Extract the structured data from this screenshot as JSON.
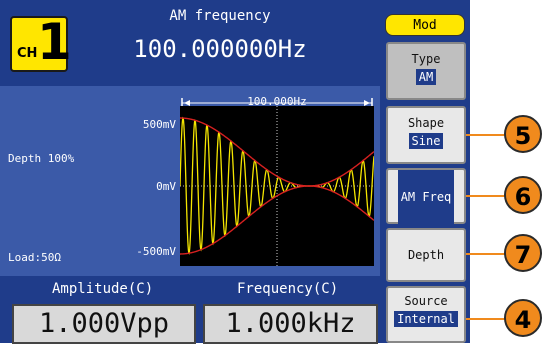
{
  "channel": {
    "label": "CH",
    "number": "1"
  },
  "parameter": {
    "title": "AM frequency",
    "value": "100.000000Hz"
  },
  "waveform": {
    "span_label": "100.000Hz",
    "depth_label": "Depth 100%",
    "load_label": "Load:50Ω",
    "y_top": "500mV",
    "y_mid": "0mV",
    "y_bottom": "-500mV",
    "carrier_color": "#f5e600",
    "envelope_color": "#d62020"
  },
  "readouts": {
    "amplitude_label": "Amplitude(C)",
    "amplitude_value": "1.000Vpp",
    "frequency_label": "Frequency(C)",
    "frequency_value": "1.000kHz"
  },
  "menu": {
    "title": "Mod",
    "softkeys": [
      {
        "label": "Type",
        "option": "AM"
      },
      {
        "label": "Shape",
        "option": "Sine"
      },
      {
        "label": "AM Freq"
      },
      {
        "label": "Depth"
      },
      {
        "label": "Source",
        "option": "Internal"
      }
    ]
  },
  "callouts": [
    "5",
    "6",
    "7",
    "4"
  ]
}
